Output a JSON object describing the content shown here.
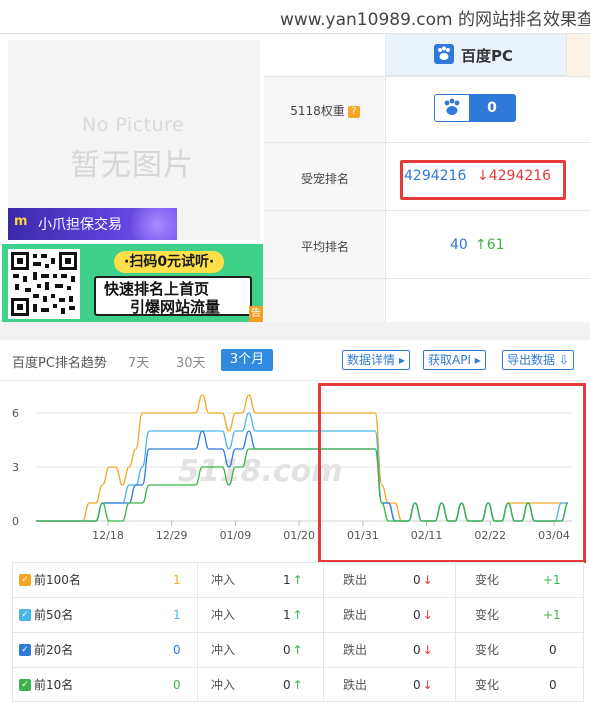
{
  "page_title": "www.yan10989.com 的网站排名效果查",
  "image_placeholder": {
    "en": "No Picture",
    "cn": "暂无图片"
  },
  "ads": {
    "banner1": "小爪担保交易",
    "banner2_badge": "·扫码0元试听·",
    "banner2_line1": "快速排名上首页",
    "banner2_line2": "引爆网站流量",
    "corner": "告"
  },
  "engine": {
    "name": "百度PC"
  },
  "rows": {
    "weight_label": "5118权重",
    "weight_help": "?",
    "weight_value": "0",
    "rank_label": "受宠排名",
    "rank_value": "4294216",
    "rank_change": "↓4294216",
    "avg_label": "平均排名",
    "avg_value": "40",
    "avg_change": "↑61"
  },
  "trend": {
    "title": "百度PC排名趋势",
    "tabs": [
      "7天",
      "30天",
      "3个月"
    ],
    "active_tab": "3个月",
    "buttons": [
      "数据详情 ▸",
      "获取API ▸",
      "导出数据 ⇩"
    ]
  },
  "chart_data": {
    "type": "line",
    "ylim": [
      0,
      7
    ],
    "yticks": [
      "0",
      "3",
      "6"
    ],
    "x_ticks": [
      "12/18",
      "12/29",
      "01/09",
      "01/20",
      "01/31",
      "02/11",
      "02/22",
      "03/04"
    ],
    "grid": true,
    "colors": {
      "top100": "#f5a623",
      "top50": "#4ab6e8",
      "top20": "#2f7ad8",
      "top10": "#3cb34a"
    },
    "watermark": "5118.com",
    "series": [
      {
        "name": "前100名",
        "color": "#f5a623",
        "values": [
          0,
          0,
          0,
          0,
          0,
          0,
          0,
          0,
          1,
          1,
          2,
          3,
          3,
          2,
          3,
          4,
          6,
          6,
          6,
          6,
          6,
          6,
          6,
          6,
          6,
          7,
          6,
          6,
          6,
          5,
          6,
          6,
          7,
          6,
          6,
          6,
          6,
          6,
          6,
          6,
          6,
          6,
          6,
          6,
          6,
          6,
          6,
          6,
          6,
          6,
          6,
          6,
          2,
          1,
          1,
          0,
          0,
          1,
          0,
          0,
          0,
          1,
          0,
          0,
          1,
          0,
          0,
          0,
          1,
          0,
          0,
          1,
          1,
          1,
          1,
          1,
          1,
          1,
          1,
          1,
          1
        ]
      },
      {
        "name": "前50名",
        "color": "#4ab6e8",
        "values": [
          0,
          0,
          0,
          0,
          0,
          0,
          0,
          0,
          0,
          0,
          1,
          1,
          1,
          1,
          2,
          2,
          3,
          5,
          5,
          5,
          5,
          5,
          5,
          5,
          5,
          5,
          5,
          5,
          5,
          4,
          5,
          5,
          6,
          5,
          5,
          5,
          5,
          5,
          5,
          5,
          5,
          5,
          5,
          5,
          5,
          5,
          5,
          5,
          5,
          5,
          5,
          5,
          1,
          1,
          0,
          0,
          0,
          1,
          0,
          0,
          0,
          1,
          0,
          0,
          1,
          0,
          0,
          0,
          1,
          0,
          0,
          1,
          0,
          0,
          1,
          0,
          0,
          0,
          0,
          1,
          1
        ]
      },
      {
        "name": "前20名",
        "color": "#2f7ad8",
        "values": [
          0,
          0,
          0,
          0,
          0,
          0,
          0,
          0,
          0,
          0,
          1,
          1,
          1,
          1,
          1,
          2,
          2,
          4,
          4,
          4,
          4,
          4,
          4,
          4,
          4,
          5,
          4,
          4,
          4,
          3,
          4,
          4,
          5,
          4,
          4,
          4,
          4,
          4,
          4,
          4,
          4,
          4,
          4,
          4,
          4,
          4,
          4,
          4,
          4,
          4,
          4,
          4,
          1,
          1,
          0,
          0,
          0,
          1,
          0,
          0,
          0,
          1,
          0,
          0,
          1,
          0,
          0,
          0,
          1,
          0,
          0,
          1,
          0,
          0,
          1,
          0,
          0,
          0,
          0,
          0,
          1
        ]
      },
      {
        "name": "前10名",
        "color": "#3cb34a",
        "values": [
          0,
          0,
          0,
          0,
          0,
          0,
          0,
          0,
          0,
          0,
          1,
          0,
          0,
          0,
          1,
          1,
          1,
          2,
          2,
          2,
          2,
          2,
          2,
          2,
          2,
          3,
          3,
          3,
          3,
          2,
          3,
          3,
          4,
          4,
          4,
          4,
          4,
          4,
          4,
          4,
          4,
          4,
          4,
          4,
          4,
          4,
          4,
          4,
          4,
          4,
          4,
          4,
          1,
          0,
          0,
          0,
          0,
          1,
          0,
          0,
          0,
          1,
          0,
          0,
          1,
          0,
          0,
          0,
          1,
          0,
          0,
          1,
          0,
          0,
          1,
          0,
          0,
          0,
          0,
          0,
          1
        ]
      }
    ]
  },
  "stats": [
    {
      "label": "前100名",
      "color": "#f5a623",
      "count": "1",
      "in_label": "冲入",
      "in_value": "1",
      "in_arrow": "↑",
      "out_label": "跌出",
      "out_value": "0",
      "out_arrow": "↓",
      "chg_label": "变化",
      "chg_value": "+1"
    },
    {
      "label": "前50名",
      "color": "#4ab6e8",
      "count": "1",
      "in_label": "冲入",
      "in_value": "1",
      "in_arrow": "↑",
      "out_label": "跌出",
      "out_value": "0",
      "out_arrow": "↓",
      "chg_label": "变化",
      "chg_value": "+1"
    },
    {
      "label": "前20名",
      "color": "#2f7ad8",
      "count": "0",
      "in_label": "冲入",
      "in_value": "0",
      "in_arrow": "↑",
      "out_label": "跌出",
      "out_value": "0",
      "out_arrow": "↓",
      "chg_label": "变化",
      "chg_value": "0"
    },
    {
      "label": "前10名",
      "color": "#3cb34a",
      "count": "0",
      "in_label": "冲入",
      "in_value": "0",
      "in_arrow": "↑",
      "out_label": "跌出",
      "out_value": "0",
      "out_arrow": "↓",
      "chg_label": "变化",
      "chg_value": "0"
    }
  ]
}
